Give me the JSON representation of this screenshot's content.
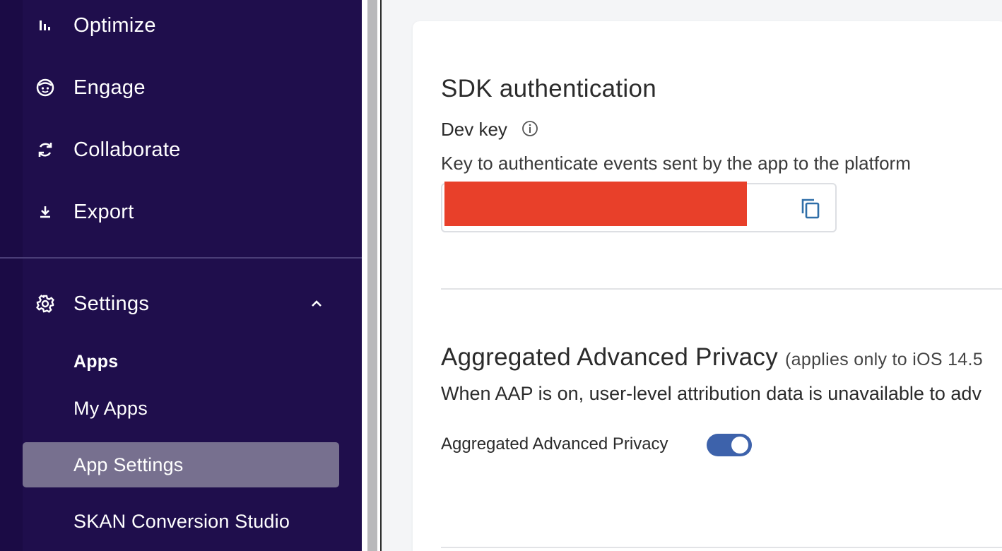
{
  "sidebar": {
    "items": [
      {
        "label": "Optimize",
        "icon": "bar-chart-icon"
      },
      {
        "label": "Engage",
        "icon": "face-icon"
      },
      {
        "label": "Collaborate",
        "icon": "sync-icon"
      },
      {
        "label": "Export",
        "icon": "download-icon"
      }
    ],
    "settings": {
      "label": "Settings",
      "icon": "gear-icon",
      "expanded": true
    },
    "sub_header": "Apps",
    "sub_items": [
      {
        "label": "My Apps",
        "active": false
      },
      {
        "label": "App Settings",
        "active": true
      },
      {
        "label": "SKAN Conversion Studio",
        "active": false
      }
    ]
  },
  "sdk": {
    "title": "SDK authentication",
    "dev_key_label": "Dev key",
    "description": "Key to authenticate events sent by the app to the platform"
  },
  "aap": {
    "title": "Aggregated Advanced Privacy",
    "title_note": "(applies only to iOS 14.5",
    "description": "When AAP is on, user-level attribution data is unavailable to adv",
    "toggle_label": "Aggregated Advanced Privacy",
    "toggle_on": true
  },
  "colors": {
    "sidebar_bg": "#1f0e4c",
    "active_item": "#77708f",
    "toggle_on": "#3d62ab",
    "redaction": "#e8402a"
  }
}
